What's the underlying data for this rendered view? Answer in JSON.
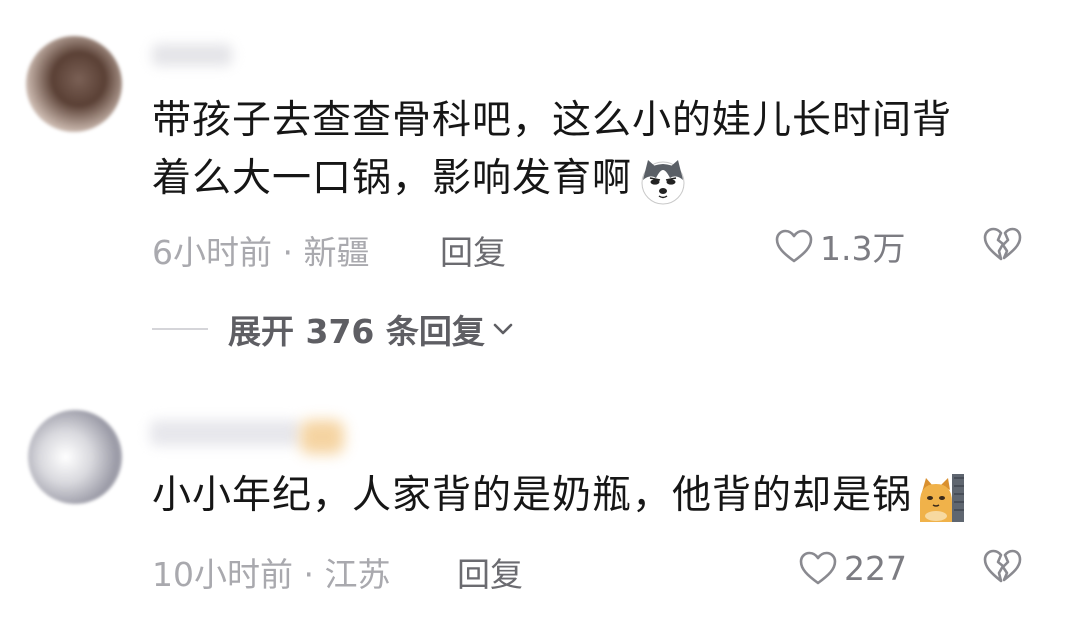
{
  "comments": [
    {
      "text_lines": [
        "带孩子去查查骨科吧，这么小的娃儿长时间背",
        "着么大一口锅，影响发育啊"
      ],
      "emoji": "husky-dog-emoji",
      "meta": "6小时前 · 新疆",
      "reply_label": "回复",
      "likes": "1.3万"
    },
    {
      "text_lines": [
        "小小年纪，人家背的是奶瓶，他背的却是锅"
      ],
      "emoji": "cat-peeking-emoji",
      "meta": "10小时前 · 江苏",
      "reply_label": "回复",
      "likes": "227"
    }
  ],
  "expand_replies": {
    "label": "展开 376 条回复"
  },
  "icons": {
    "like": "heart-outline-icon",
    "dislike": "broken-heart-icon",
    "expand": "chevron-down-icon"
  },
  "colors": {
    "text": "#161616",
    "meta": "#a9a9ae",
    "reply": "#6b6b70",
    "expand": "#5e5e63"
  }
}
